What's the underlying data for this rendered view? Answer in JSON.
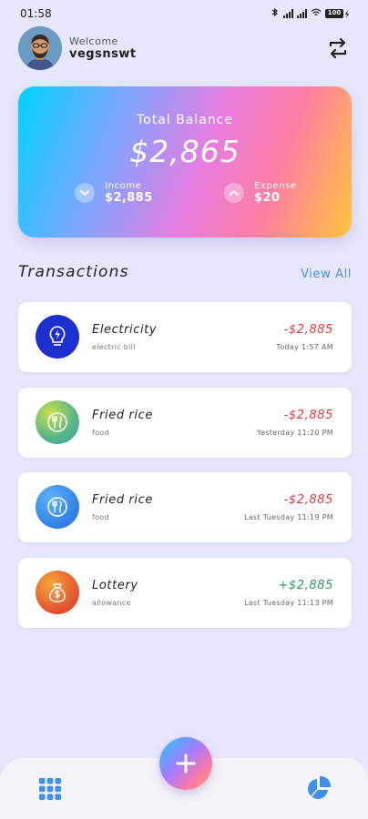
{
  "status_bar": {
    "time": "01:58",
    "battery": "100"
  },
  "header": {
    "welcome": "Welcome",
    "username": "vegsnswt",
    "avatar_icon": "user-avatar",
    "sync_icon": "sync-icon"
  },
  "balance": {
    "title": "Total Balance",
    "amount": "$2,865",
    "income": {
      "label": "Income",
      "value": "$2,885",
      "icon": "chevron-down-icon"
    },
    "expense": {
      "label": "Expense",
      "value": "$20",
      "icon": "chevron-up-icon"
    }
  },
  "transactions": {
    "title": "Transactions",
    "view_all": "View All",
    "items": [
      {
        "name": "Electricity",
        "category": "electric bill",
        "amount": "-$2,885",
        "time": "Today 1:57 AM",
        "icon": "lightbulb-icon",
        "type": "expense"
      },
      {
        "name": "Fried rice",
        "category": "food",
        "amount": "-$2,885",
        "time": "Yesterday 11:20 PM",
        "icon": "food-icon",
        "type": "expense"
      },
      {
        "name": "Fried rice",
        "category": "food",
        "amount": "-$2,885",
        "time": "Last Tuesday 11:19 PM",
        "icon": "food-icon",
        "type": "expense"
      },
      {
        "name": "Lottery",
        "category": "allowance",
        "amount": "+$2,885",
        "time": "Last Tuesday 11:13 PM",
        "icon": "money-bag-icon",
        "type": "income"
      }
    ]
  },
  "bottom_nav": {
    "left_icon": "grid-icon",
    "center_icon": "add-icon",
    "right_icon": "pie-chart-icon"
  },
  "colors": {
    "background": "#e7e7fb",
    "accent": "#4a8fe7",
    "expense": "#e5393a",
    "income": "#2c9a5b"
  }
}
